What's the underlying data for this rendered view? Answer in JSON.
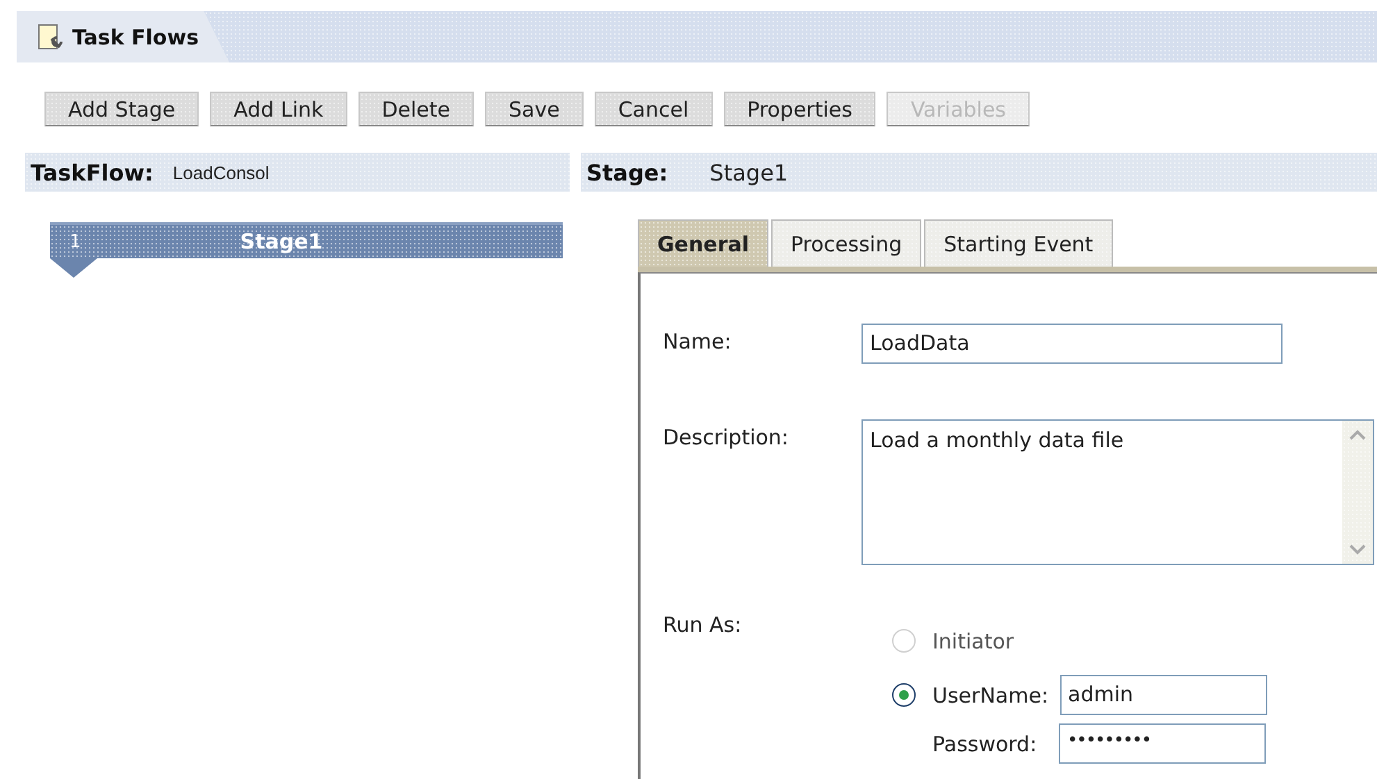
{
  "window": {
    "title": "Task Flows"
  },
  "toolbar": [
    {
      "label": "Add Stage",
      "disabled": false
    },
    {
      "label": "Add Link",
      "disabled": false
    },
    {
      "label": "Delete",
      "disabled": false
    },
    {
      "label": "Save",
      "disabled": false
    },
    {
      "label": "Cancel",
      "disabled": false
    },
    {
      "label": "Properties",
      "disabled": false
    },
    {
      "label": "Variables",
      "disabled": true
    }
  ],
  "taskflow": {
    "label": "TaskFlow:",
    "value": "LoadConsol"
  },
  "stage_header": {
    "label": "Stage:",
    "value": "Stage1"
  },
  "stages": [
    {
      "number": "1",
      "name": "Stage1",
      "selected": true
    }
  ],
  "tabs": [
    {
      "label": "General",
      "selected": true
    },
    {
      "label": "Processing",
      "selected": false
    },
    {
      "label": "Starting Event",
      "selected": false
    }
  ],
  "form": {
    "name": {
      "label": "Name:",
      "value": "LoadData"
    },
    "description": {
      "label": "Description:",
      "value": "Load a monthly data file"
    },
    "run_as": {
      "label": "Run As:",
      "options": [
        {
          "label": "Initiator",
          "selected": false,
          "disabled": true
        },
        {
          "label": "UserName:",
          "selected": true,
          "disabled": false
        }
      ],
      "username": "admin",
      "password_label": "Password:",
      "password": "•••••••••"
    }
  }
}
